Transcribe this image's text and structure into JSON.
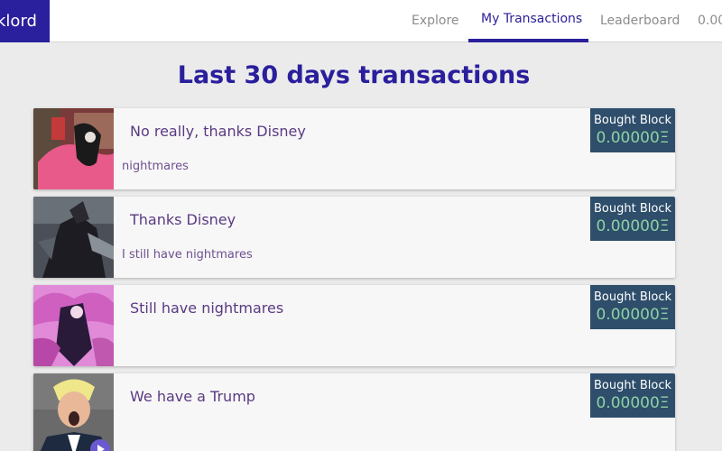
{
  "nav": {
    "logo_text": "klord",
    "items": [
      {
        "label": "Explore"
      },
      {
        "label": "My Transactions"
      },
      {
        "label": "Leaderboard"
      },
      {
        "label": "0.00"
      }
    ],
    "active": "My Transactions"
  },
  "page": {
    "title": "Last 30 days transactions"
  },
  "transactions": [
    {
      "title": "No really, thanks Disney",
      "description": "nightmares",
      "status": "Bought Block",
      "price": "0.00000Ξ"
    },
    {
      "title": "Thanks Disney",
      "description": "I still have nightmares",
      "status": "Bought Block",
      "price": "0.00000Ξ"
    },
    {
      "title": "Still have nightmares",
      "description": "",
      "status": "Bought Block",
      "price": "0.00000Ξ"
    },
    {
      "title": "We have a Trump",
      "description": "",
      "status": "Bought Block",
      "price": "0.00000Ξ"
    }
  ],
  "colors": {
    "brand": "#2a1f9c",
    "badge_bg": "#2e4e6b",
    "price": "#8ed1a4",
    "title_text": "#5a3a82"
  }
}
